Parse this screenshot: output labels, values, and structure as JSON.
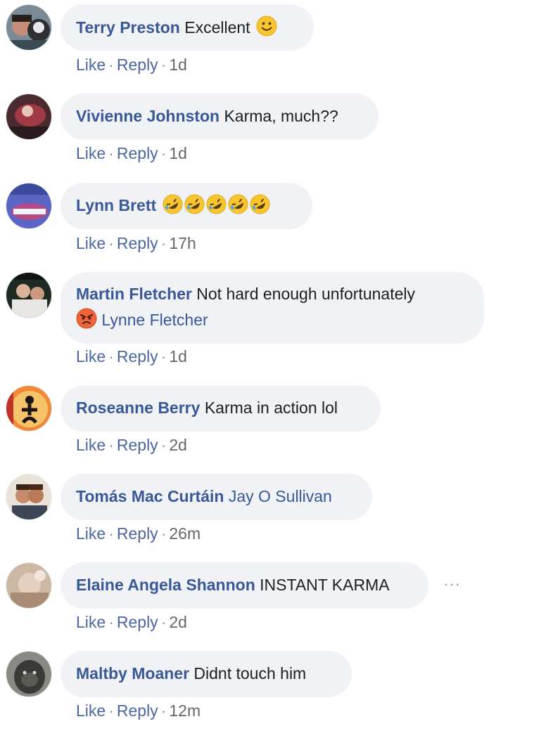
{
  "comments": [
    {
      "name": "Terry Preston",
      "text": "Excellent",
      "emoji": "slightly-smiling-face-icon",
      "like": "Like",
      "reply": "Reply",
      "time": "1d"
    },
    {
      "name": "Vivienne Johnston",
      "text": "Karma, much??",
      "like": "Like",
      "reply": "Reply",
      "time": "1d"
    },
    {
      "name": "Lynn Brett",
      "text": "",
      "emoji": "rolling-on-floor-laughing-icon",
      "emoji_count": 5,
      "like": "Like",
      "reply": "Reply",
      "time": "17h"
    },
    {
      "name": "Martin Fletcher",
      "text": "Not hard enough unfortunately",
      "mention": "Lynne Fletcher",
      "emoji": "angry-face-icon",
      "like": "Like",
      "reply": "Reply",
      "time": "1d"
    },
    {
      "name": "Roseanne Berry",
      "text": "Karma in action lol",
      "like": "Like",
      "reply": "Reply",
      "time": "2d"
    },
    {
      "name": "Tomás Mac Curtáin",
      "mention": "Jay O Sullivan",
      "like": "Like",
      "reply": "Reply",
      "time": "26m"
    },
    {
      "name": "Elaine Angela Shannon",
      "text": "INSTANT KARMA",
      "like": "Like",
      "reply": "Reply",
      "time": "2d"
    },
    {
      "name": "Maltby Moaner",
      "text": "Didnt touch him",
      "like": "Like",
      "reply": "Reply",
      "time": "12m"
    }
  ],
  "separator": "·",
  "more_options": "···",
  "colors": {
    "name": "#385898",
    "bubble": "#f0f2f5",
    "meta": "#65676b"
  }
}
